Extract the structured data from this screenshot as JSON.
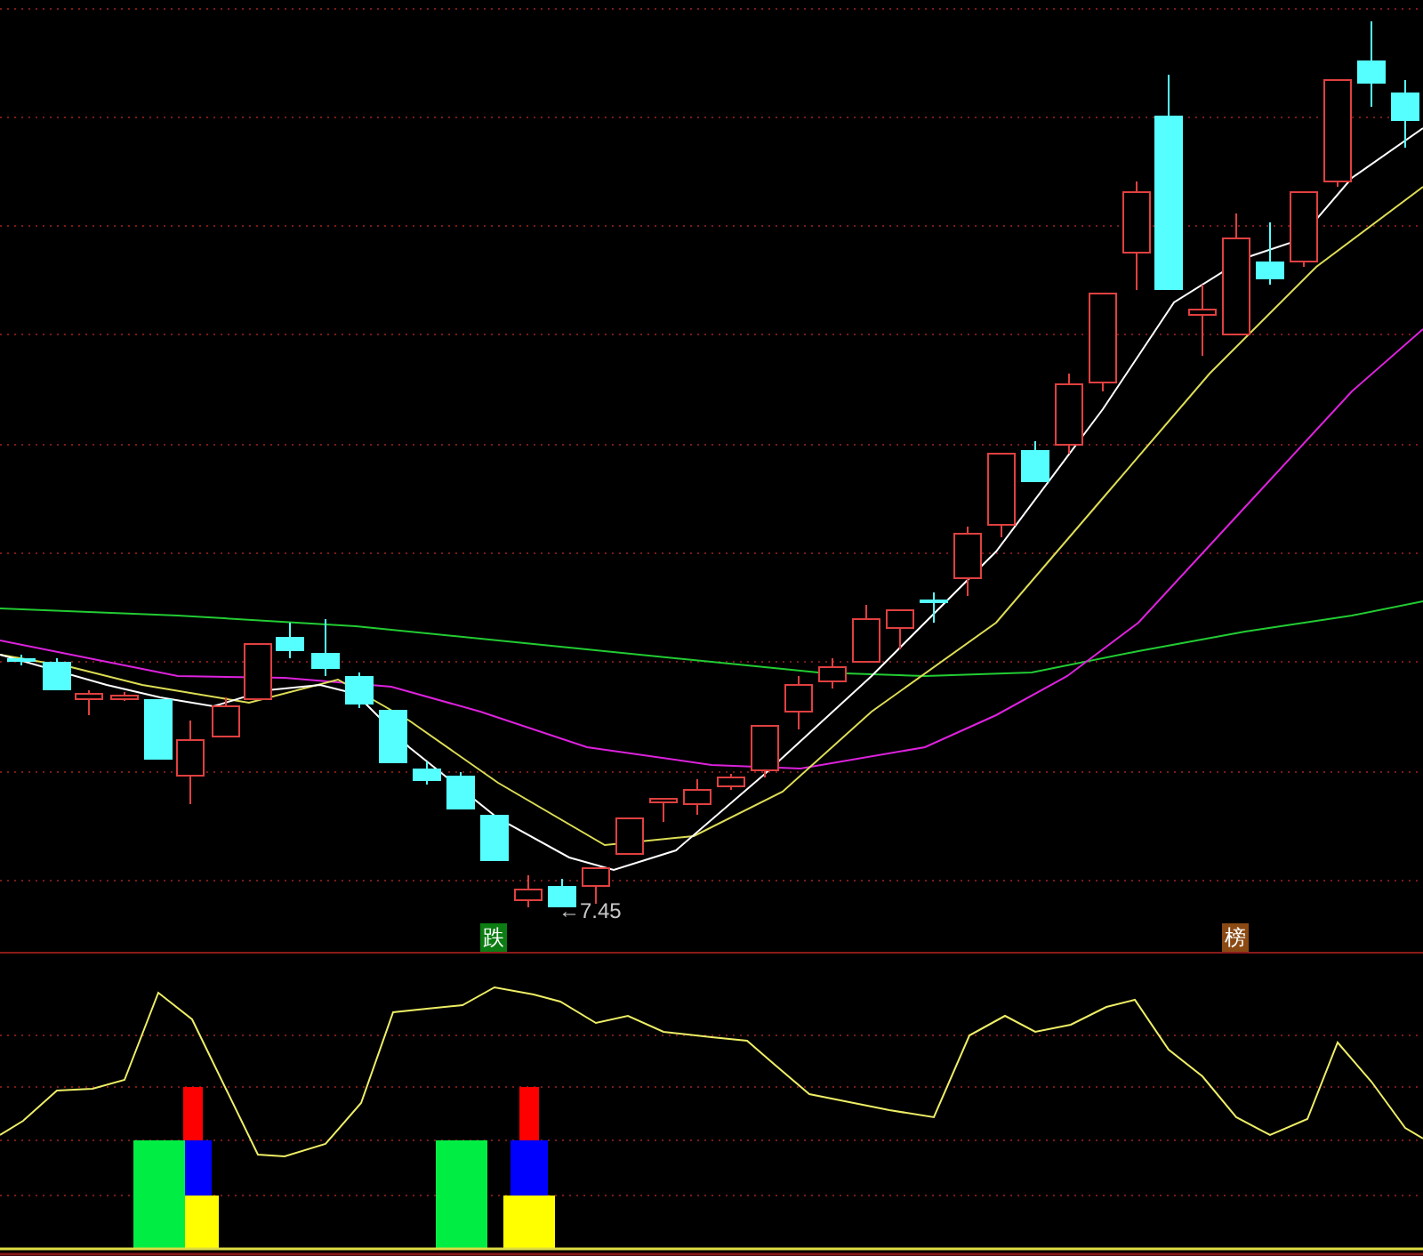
{
  "price_chart": {
    "low_label": "←7.45",
    "signals": [
      {
        "label": "跌",
        "color": "#0b7d12"
      },
      {
        "label": "榜",
        "color": "#8b4a14"
      }
    ]
  }
}
